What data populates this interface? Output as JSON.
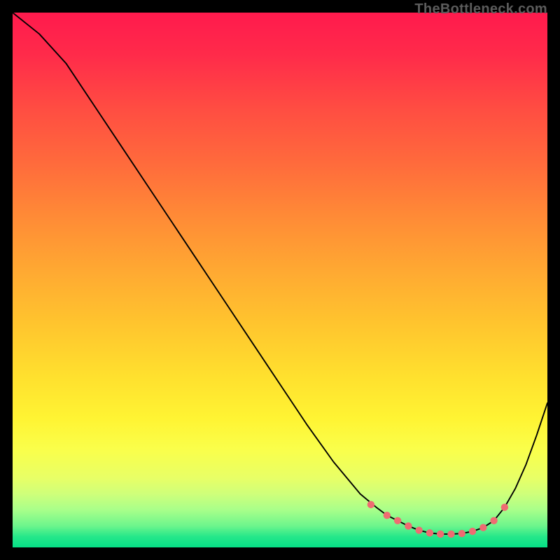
{
  "attribution": "TheBottleneck.com",
  "colors": {
    "page_bg": "#000000",
    "gradient_top": "#ff1a4d",
    "gradient_bottom": "#06df86",
    "curve": "#000000",
    "dots": "#ef6b72"
  },
  "chart_data": {
    "type": "line",
    "title": "",
    "xlabel": "",
    "ylabel": "",
    "xlim": [
      0,
      100
    ],
    "ylim": [
      0,
      100
    ],
    "x": [
      0,
      5,
      10,
      15,
      20,
      25,
      30,
      35,
      40,
      45,
      50,
      55,
      60,
      65,
      68,
      70,
      72,
      74,
      76,
      78,
      80,
      82,
      84,
      86,
      88,
      90,
      92,
      94,
      96,
      98,
      100
    ],
    "y": [
      100,
      96,
      90.5,
      83,
      75.5,
      68,
      60.5,
      53,
      45.5,
      38,
      30.5,
      23,
      16,
      10,
      7.5,
      6,
      5,
      4,
      3.2,
      2.7,
      2.5,
      2.5,
      2.6,
      3,
      3.7,
      5,
      7.5,
      11,
      15.5,
      21,
      27
    ],
    "highlighted_points": {
      "x": [
        67,
        70,
        72,
        74,
        76,
        78,
        80,
        82,
        84,
        86,
        88,
        90,
        92
      ],
      "y": [
        8,
        6,
        5,
        4,
        3.2,
        2.7,
        2.5,
        2.5,
        2.6,
        3,
        3.7,
        5,
        7.5
      ]
    },
    "background": {
      "type": "vertical-gradient",
      "meaning": "red (top) = worse / high bottleneck, green (bottom) = optimal"
    }
  }
}
